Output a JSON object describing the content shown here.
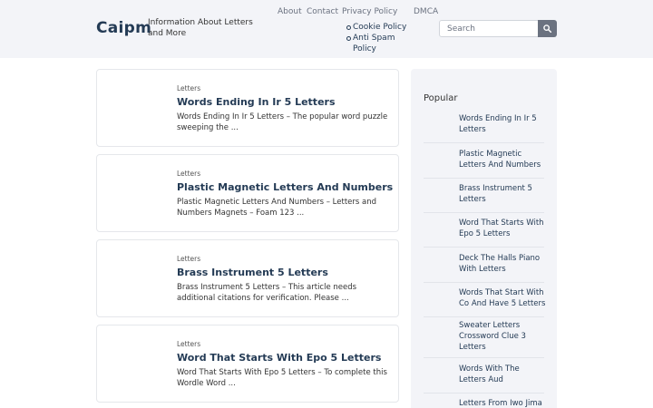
{
  "header": {
    "brand": "Caipm",
    "tagline": "Information About Letters and More",
    "nav": [
      "About",
      "Contact",
      "Privacy Policy",
      "DMCA"
    ],
    "subnav": [
      "Cookie Policy",
      "Anti Spam Policy"
    ],
    "search": {
      "placeholder": "Search",
      "button_icon": "search-icon"
    }
  },
  "posts": [
    {
      "category": "Letters",
      "title": "Words Ending In Ir 5 Letters",
      "excerpt": "Words Ending In Ir 5 Letters – The popular word puzzle sweeping the ..."
    },
    {
      "category": "Letters",
      "title": "Plastic Magnetic Letters And Numbers",
      "excerpt": "Plastic Magnetic Letters And Numbers – Letters and Numbers Magnets – Foam 123 ..."
    },
    {
      "category": "Letters",
      "title": "Brass Instrument 5 Letters",
      "excerpt": "Brass Instrument 5 Letters – This article needs additional citations for verification. Please ..."
    },
    {
      "category": "Letters",
      "title": "Word That Starts With Epo 5 Letters",
      "excerpt": "Word That Starts With Epo 5 Letters – To complete this Wordle Word ..."
    }
  ],
  "sidebar": {
    "heading": "Popular",
    "items": [
      "Words Ending In Ir 5 Letters",
      "Plastic Magnetic Letters And Numbers",
      "Brass Instrument 5 Letters",
      "Word That Starts With Epo 5 Letters",
      "Deck The Halls Piano With Letters",
      "Words That Start With Co And Have 5 Letters",
      "Sweater Letters Crossword Clue 3 Letters",
      "Words With The Letters Aud",
      "Letters From Iwo Jima"
    ]
  }
}
